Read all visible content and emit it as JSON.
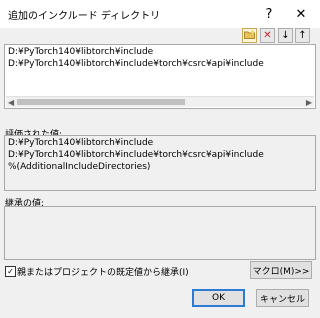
{
  "window": {
    "title": "追加のインクルード ディレクトリ",
    "help_glyph": "?",
    "close_glyph": "✕"
  },
  "toolbar": {
    "new_icon": "folder-icon",
    "delete_icon": "delete-icon",
    "down_icon": "arrow-down-icon",
    "up_icon": "arrow-up-icon",
    "delete_glyph": "✕",
    "down_glyph": "↓",
    "up_glyph": "↑"
  },
  "include_dirs": {
    "lines": [
      "D:¥PyTorch140¥libtorch¥include",
      "D:¥PyTorch140¥libtorch¥include¥torch¥csrc¥api¥include"
    ]
  },
  "evaluated": {
    "label": "評価された値:",
    "lines": [
      "D:¥PyTorch140¥libtorch¥include",
      "D:¥PyTorch140¥libtorch¥include¥torch¥csrc¥api¥include",
      "%(AdditionalIncludeDirectories)"
    ]
  },
  "inherited": {
    "label": "継承の値:"
  },
  "inherit_checkbox": {
    "label": "親またはプロジェクトの既定値から継承(I)",
    "checked": true,
    "check_glyph": "✓"
  },
  "buttons": {
    "macro": "マクロ(M)>>",
    "ok": "OK",
    "cancel": "キャンセル"
  },
  "colors": {
    "ok_border": "#2a7ad6",
    "delete_red": "#c0252a"
  }
}
